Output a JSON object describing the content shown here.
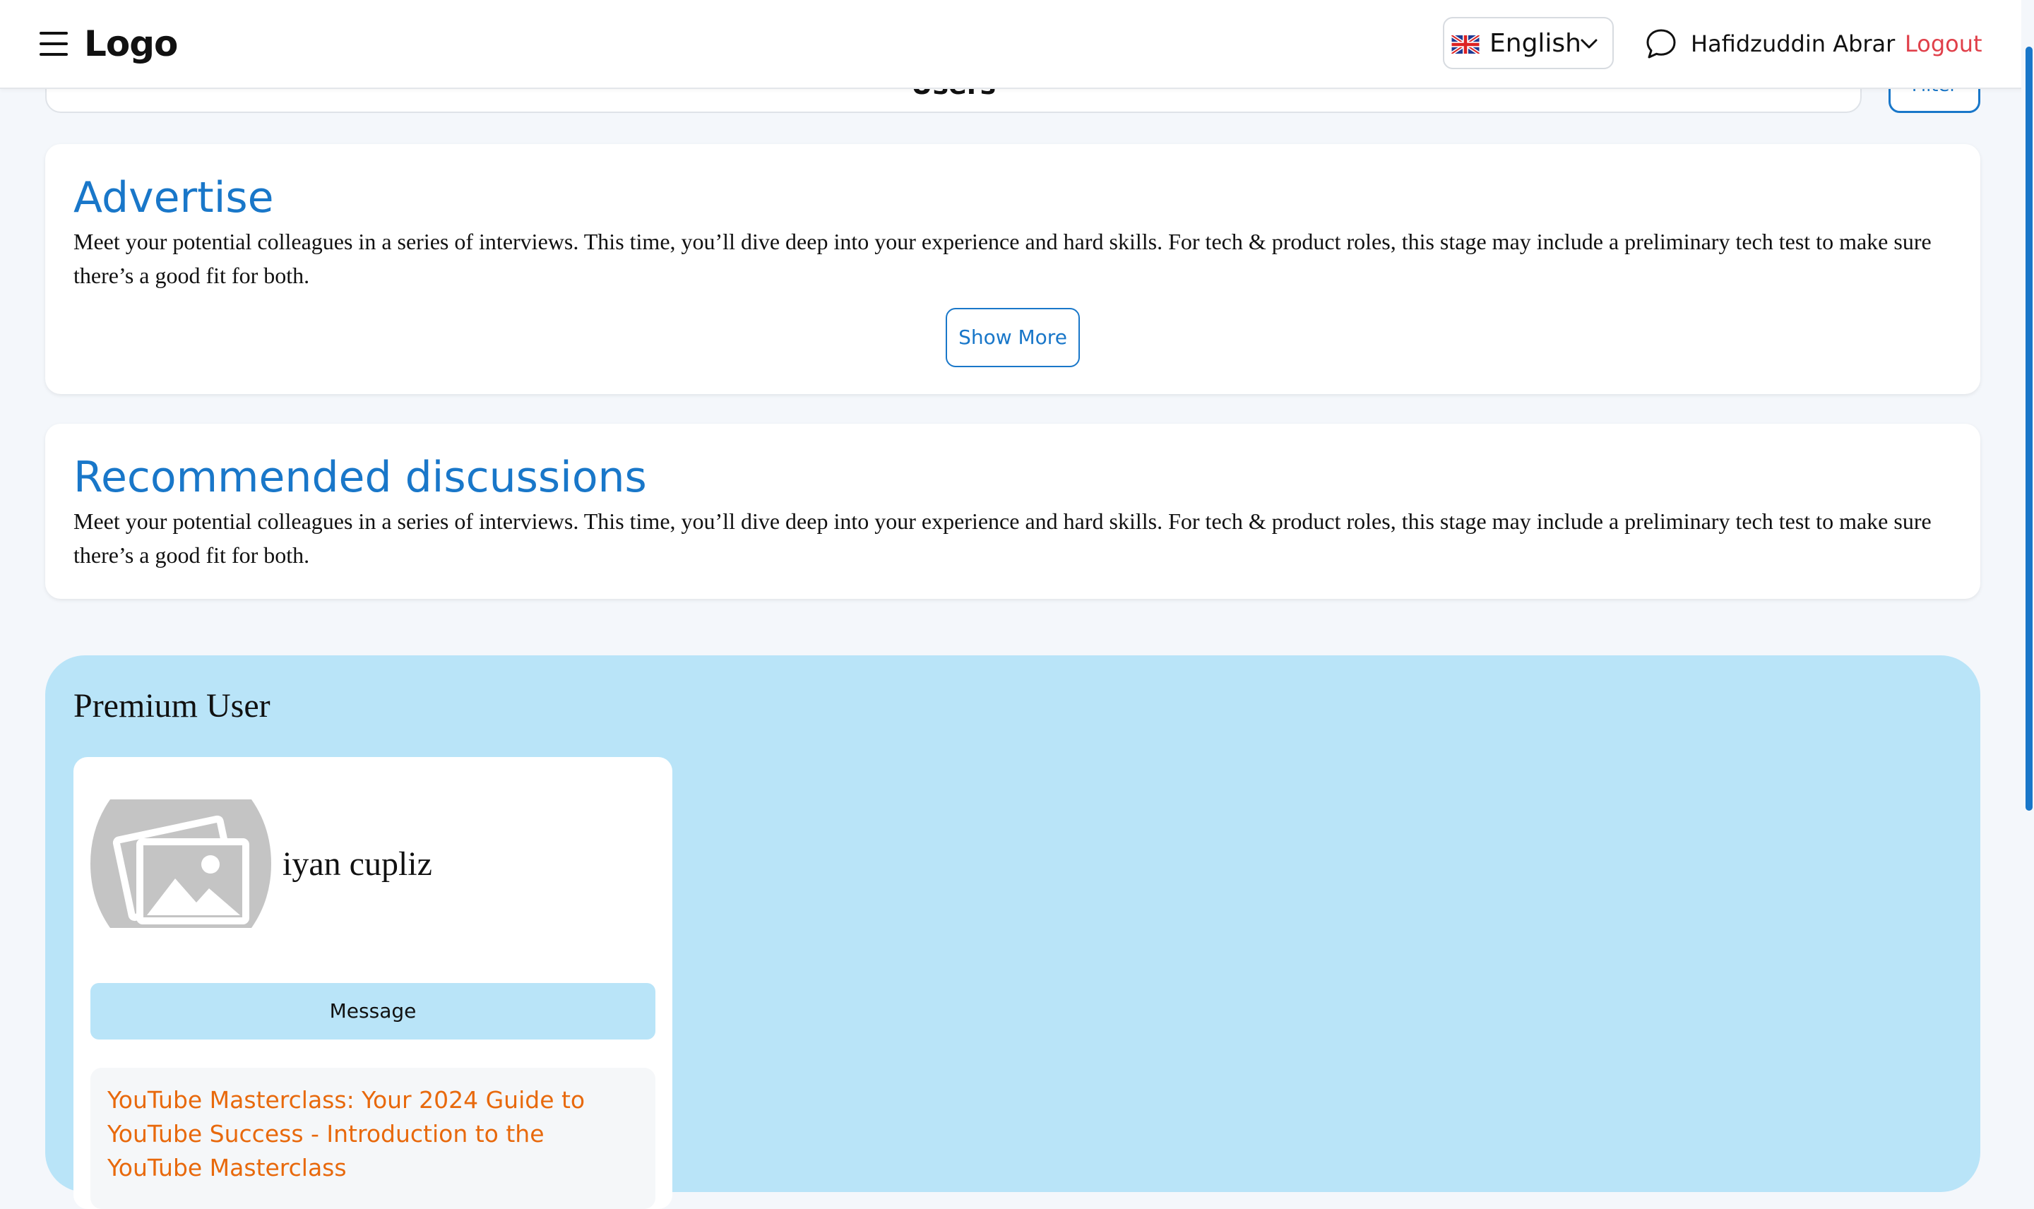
{
  "header": {
    "logo": "Logo",
    "language": "English",
    "user_name": "Hafidzuddin Abrar",
    "logout_label": "Logout"
  },
  "users_bar": {
    "title": "Users",
    "filter_label": "Filter"
  },
  "advertise": {
    "title": "Advertise",
    "text": "Meet your potential colleagues in a series of interviews. This time, you’ll dive deep into your experience and hard skills. For tech & product roles, this stage may include a preliminary tech test to make sure there’s a good fit for both.",
    "show_more_label": "Show More"
  },
  "recommended": {
    "title": "Recommended discussions",
    "text": "Meet your potential colleagues in a series of interviews. This time, you’ll dive deep into your experience and hard skills. For tech & product roles, this stage may include a preliminary tech test to make sure there’s a good fit for both."
  },
  "premium": {
    "title": "Premium User",
    "user": {
      "name": "iyan cupliz",
      "message_label": "Message",
      "course_title": "YouTube Masterclass: Your 2024 Guide to YouTube Success - Introduction to the YouTube Masterclass"
    }
  },
  "colors": {
    "accent": "#1977c9",
    "logout": "#e0404a",
    "premium_bg": "#b9e4f8",
    "course_link": "#e8690c"
  },
  "icons": [
    "hamburger-menu-icon",
    "uk-flag-icon",
    "chevron-down-icon",
    "chat-bubble-icon",
    "image-placeholder-icon"
  ]
}
